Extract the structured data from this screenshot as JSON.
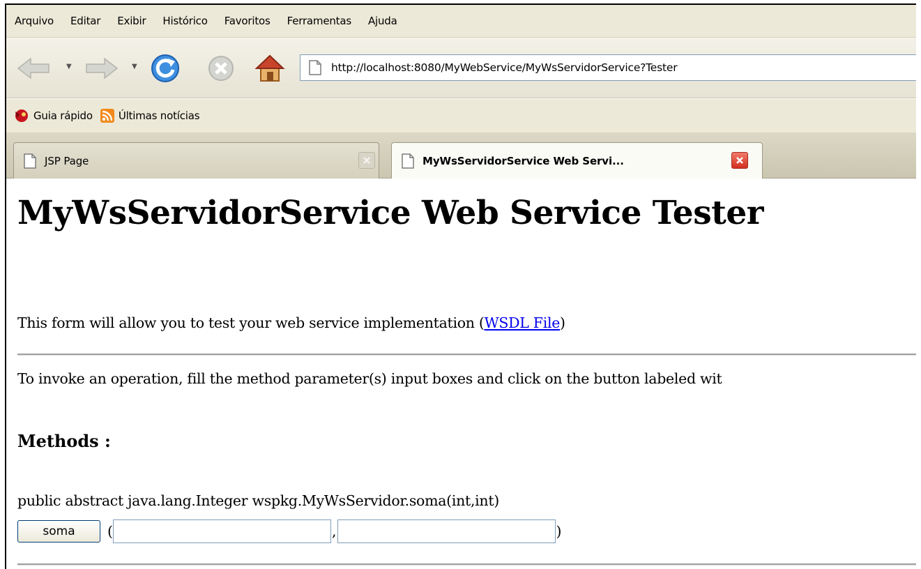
{
  "menu": [
    "Arquivo",
    "Editar",
    "Exibir",
    "Histórico",
    "Favoritos",
    "Ferramentas",
    "Ajuda"
  ],
  "navbar": {
    "url": "http://localhost:8080/MyWebService/MyWsServidorService?Tester",
    "icons": [
      "back-arrow-icon",
      "forward-arrow-icon",
      "reload-icon",
      "stop-icon",
      "home-icon",
      "page-icon"
    ]
  },
  "bookmarks": [
    {
      "label": "Guia rápido",
      "icon": "firefox-icon"
    },
    {
      "label": "Últimas notícias",
      "icon": "rss-feed-icon"
    }
  ],
  "tabs": [
    {
      "label": "JSP Page",
      "active": false
    },
    {
      "label": "MyWsServidorService Web Servi...",
      "active": true
    }
  ],
  "page": {
    "title": "MyWsServidorService Web Service Tester",
    "intro_text": "This form will allow you to test your web service implementation (",
    "wsdl_link": "WSDL File",
    "intro_end": ")",
    "instructions": "To invoke an operation, fill the method parameter(s) input boxes and click on the button labeled wit",
    "methods_heading": "Methods :",
    "method_signature": "public abstract java.lang.Integer wspkg.MyWsServidor.soma(int,int)",
    "method_button": "soma",
    "open_paren": "(",
    "comma": ",",
    "close_paren": ")",
    "param1_value": "",
    "param2_value": ""
  },
  "colors": {
    "chrome_bg": "#ece9d8",
    "link": "#0000ee",
    "tab_close_active": "#d2301f",
    "reload_blue": "#2f7fd6"
  }
}
